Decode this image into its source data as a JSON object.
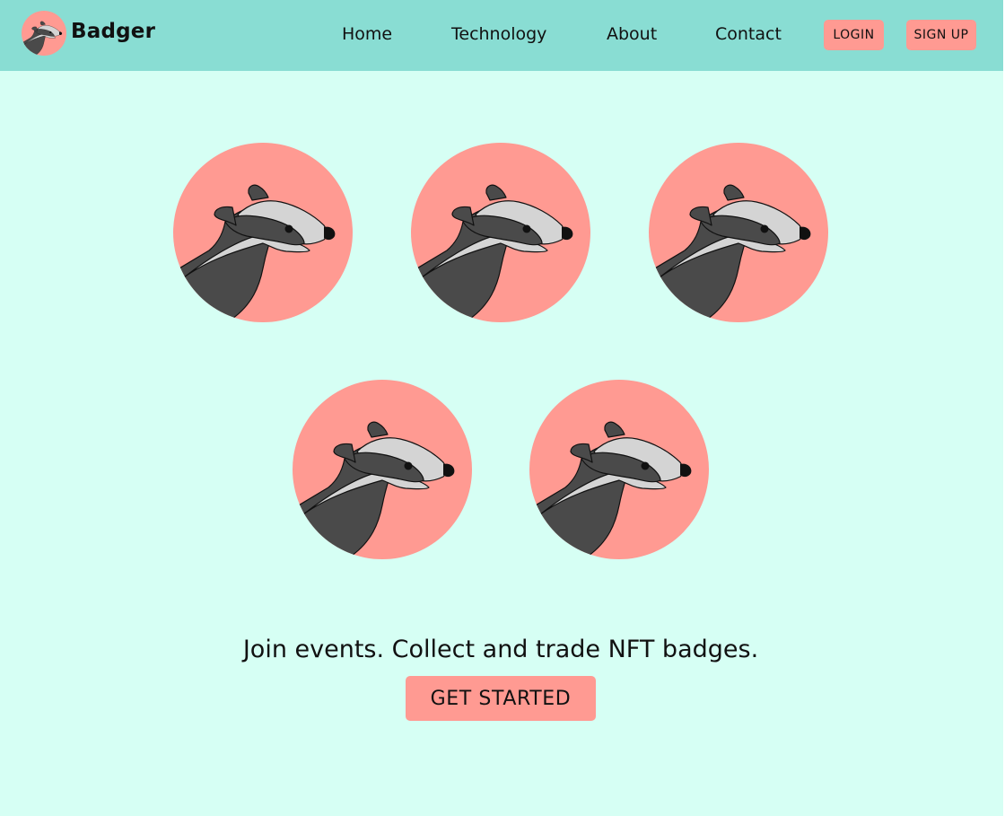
{
  "colors": {
    "background": "#d6fff4",
    "navbar": "#89ddd3",
    "accent": "#ff9a92",
    "badger_dark": "#4a4a4a",
    "badger_light": "#d4d4d4"
  },
  "header": {
    "brand": {
      "name": "Badger",
      "logo_icon": "badger-head-icon"
    },
    "nav": [
      {
        "label": "Home"
      },
      {
        "label": "Technology"
      },
      {
        "label": "About"
      },
      {
        "label": "Contact"
      }
    ],
    "login_label": "LOGIN",
    "signup_label": "SIGN UP"
  },
  "hero": {
    "badges": [
      {
        "icon": "badger-badge-icon"
      },
      {
        "icon": "badger-badge-icon"
      },
      {
        "icon": "badger-badge-icon"
      },
      {
        "icon": "badger-badge-icon"
      },
      {
        "icon": "badger-badge-icon"
      }
    ],
    "tagline": "Join events. Collect and trade NFT badges.",
    "cta_label": "GET STARTED"
  }
}
